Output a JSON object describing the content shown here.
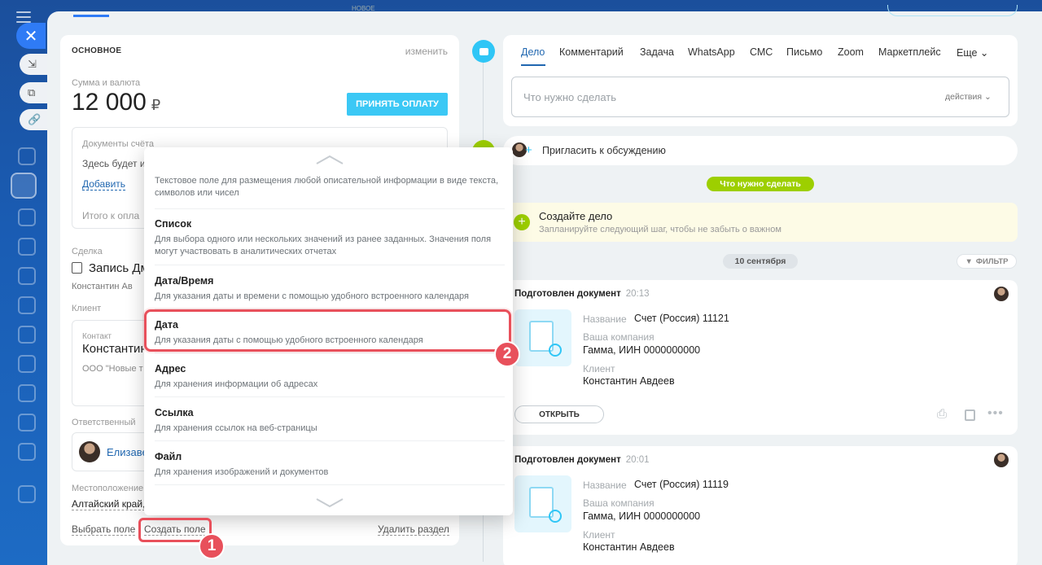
{
  "left": {
    "section_title": "ОСНОВНОЕ",
    "edit": "изменить",
    "amount_label": "Сумма и валюта",
    "amount": "12 000",
    "currency": "₽",
    "pay_button": "ПРИНЯТЬ ОПЛАТУ",
    "docs_label": "Документы счёта",
    "docs_placeholder": "Здесь будет и",
    "add_link": "Добавить",
    "payment_placeholder": "Итого к опла",
    "deal_label": "Сделка",
    "deal_value": "Запись Дм",
    "deal_person": "Константин Ав",
    "client_label": "Клиент",
    "contact_label": "Контакт",
    "contact_value": "Константин",
    "company_value": "ООО \"Новые т",
    "responsible_label": "Ответственный",
    "responsible_value": "Елизаве",
    "location_label": "Местоположение",
    "location_value": "Алтайский край,",
    "select_field": "Выбрать поле",
    "create_field": "Создать поле",
    "delete_section": "Удалить раздел"
  },
  "dropdown": {
    "items": [
      {
        "title": "",
        "desc": "Текстовое поле для размещения любой описательной информации в виде текста, символов или чисел"
      },
      {
        "title": "Список",
        "desc": "Для выбора одного или нескольких значений из ранее заданных. Значения поля могут участвовать в аналитических отчетах"
      },
      {
        "title": "Дата/Время",
        "desc": "Для указания даты и времени с помощью удобного встроенного календаря"
      },
      {
        "title": "Дата",
        "desc": "Для указания даты с помощью удобного встроенного календаря"
      },
      {
        "title": "Адрес",
        "desc": "Для хранения информации об адресах"
      },
      {
        "title": "Ссылка",
        "desc": "Для хранения ссылок на веб-страницы"
      },
      {
        "title": "Файл",
        "desc": "Для хранения изображений и документов"
      }
    ]
  },
  "badges": {
    "one": "1",
    "two": "2"
  },
  "top": {
    "new_label": "НОВОЕ"
  },
  "timeline": {
    "tabs": [
      "Дело",
      "Комментарий",
      "Задача",
      "WhatsApp",
      "СМС",
      "Письмо",
      "Zoom",
      "Маркетплейс",
      "Еще"
    ],
    "todo_placeholder": "Что нужно сделать",
    "actions": "действия",
    "invite": "Пригласить к обсуждению",
    "todo_pill": "Что нужно сделать",
    "create_case_title": "Создайте дело",
    "create_case_sub": "Запланируйте следующий шаг, чтобы не забыть о важном",
    "date_pill": "10 сентября",
    "filter": "ФИЛЬТР",
    "doc1": {
      "head": "Подготовлен документ",
      "time": "20:13",
      "name_label": "Название",
      "name_value": "Счет (Россия) 11121",
      "company_label": "Ваша компания",
      "company_value": "Гамма, ИИН 0000000000",
      "client_label": "Клиент",
      "client_value": "Константин Авдеев",
      "open": "ОТКРЫТЬ"
    },
    "doc2": {
      "head": "Подготовлен документ",
      "time": "20:01",
      "name_label": "Название",
      "name_value": "Счет (Россия) 11119",
      "company_label": "Ваша компания",
      "company_value": "Гамма, ИИН 0000000000",
      "client_label": "Клиент",
      "client_value": "Константин Авдеев"
    }
  },
  "colors": {
    "accent": "#2f7bf5",
    "highlight": "#e8505b",
    "green": "#9dcf00",
    "pay": "#3bc8f5"
  }
}
